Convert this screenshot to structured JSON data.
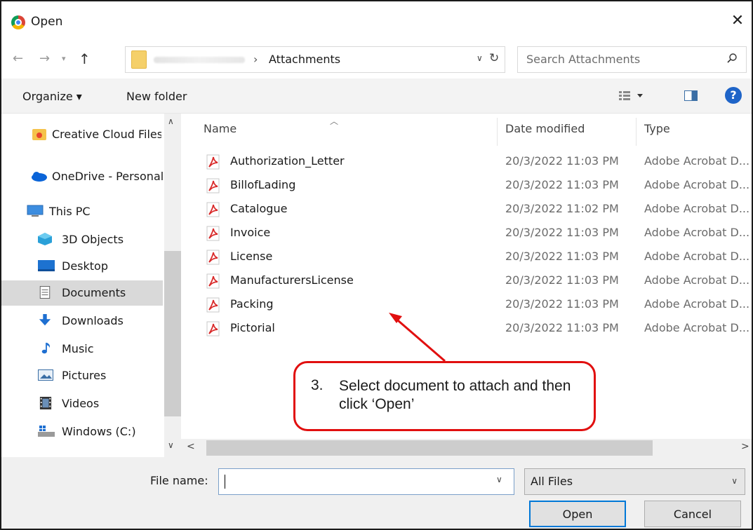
{
  "window": {
    "title": "Open",
    "close_glyph": "✕"
  },
  "address": {
    "crumb_separator": "›",
    "current_folder": "Attachments",
    "search_placeholder": "Search Attachments"
  },
  "toolbar": {
    "organize": "Organize ▾",
    "new_folder": "New folder",
    "help_glyph": "?"
  },
  "nav": {
    "items": [
      {
        "label": "Creative Cloud Files",
        "icon": "creative-cloud-icon"
      },
      {
        "label": "OneDrive - Personal",
        "icon": "onedrive-icon"
      },
      {
        "label": "This PC",
        "icon": "pc-icon"
      },
      {
        "label": "3D Objects",
        "icon": "3d-objects-icon"
      },
      {
        "label": "Desktop",
        "icon": "desktop-icon"
      },
      {
        "label": "Documents",
        "icon": "documents-icon",
        "selected": true
      },
      {
        "label": "Downloads",
        "icon": "downloads-icon"
      },
      {
        "label": "Music",
        "icon": "music-icon"
      },
      {
        "label": "Pictures",
        "icon": "pictures-icon"
      },
      {
        "label": "Videos",
        "icon": "videos-icon"
      },
      {
        "label": "Windows (C:)",
        "icon": "drive-icon"
      }
    ]
  },
  "files": {
    "columns": {
      "name": "Name",
      "date": "Date modified",
      "type": "Type"
    },
    "rows": [
      {
        "name": "Authorization_Letter",
        "date": "20/3/2022 11:03 PM",
        "type": "Adobe Acrobat D..."
      },
      {
        "name": "BillofLading",
        "date": "20/3/2022 11:03 PM",
        "type": "Adobe Acrobat D..."
      },
      {
        "name": "Catalogue",
        "date": "20/3/2022 11:02 PM",
        "type": "Adobe Acrobat D..."
      },
      {
        "name": "Invoice",
        "date": "20/3/2022 11:03 PM",
        "type": "Adobe Acrobat D..."
      },
      {
        "name": "License",
        "date": "20/3/2022 11:03 PM",
        "type": "Adobe Acrobat D..."
      },
      {
        "name": "ManufacturersLicense",
        "date": "20/3/2022 11:03 PM",
        "type": "Adobe Acrobat D..."
      },
      {
        "name": "Packing",
        "date": "20/3/2022 11:03 PM",
        "type": "Adobe Acrobat D..."
      },
      {
        "name": "Pictorial",
        "date": "20/3/2022 11:03 PM",
        "type": "Adobe Acrobat D..."
      }
    ]
  },
  "bottom": {
    "file_name_label": "File name:",
    "file_name_value": "",
    "filter_value": "All Files",
    "open_label": "Open",
    "cancel_label": "Cancel"
  },
  "annotation": {
    "number": "3.",
    "text": "Select document to attach and then click ‘Open’",
    "color": "#e10f0f"
  }
}
